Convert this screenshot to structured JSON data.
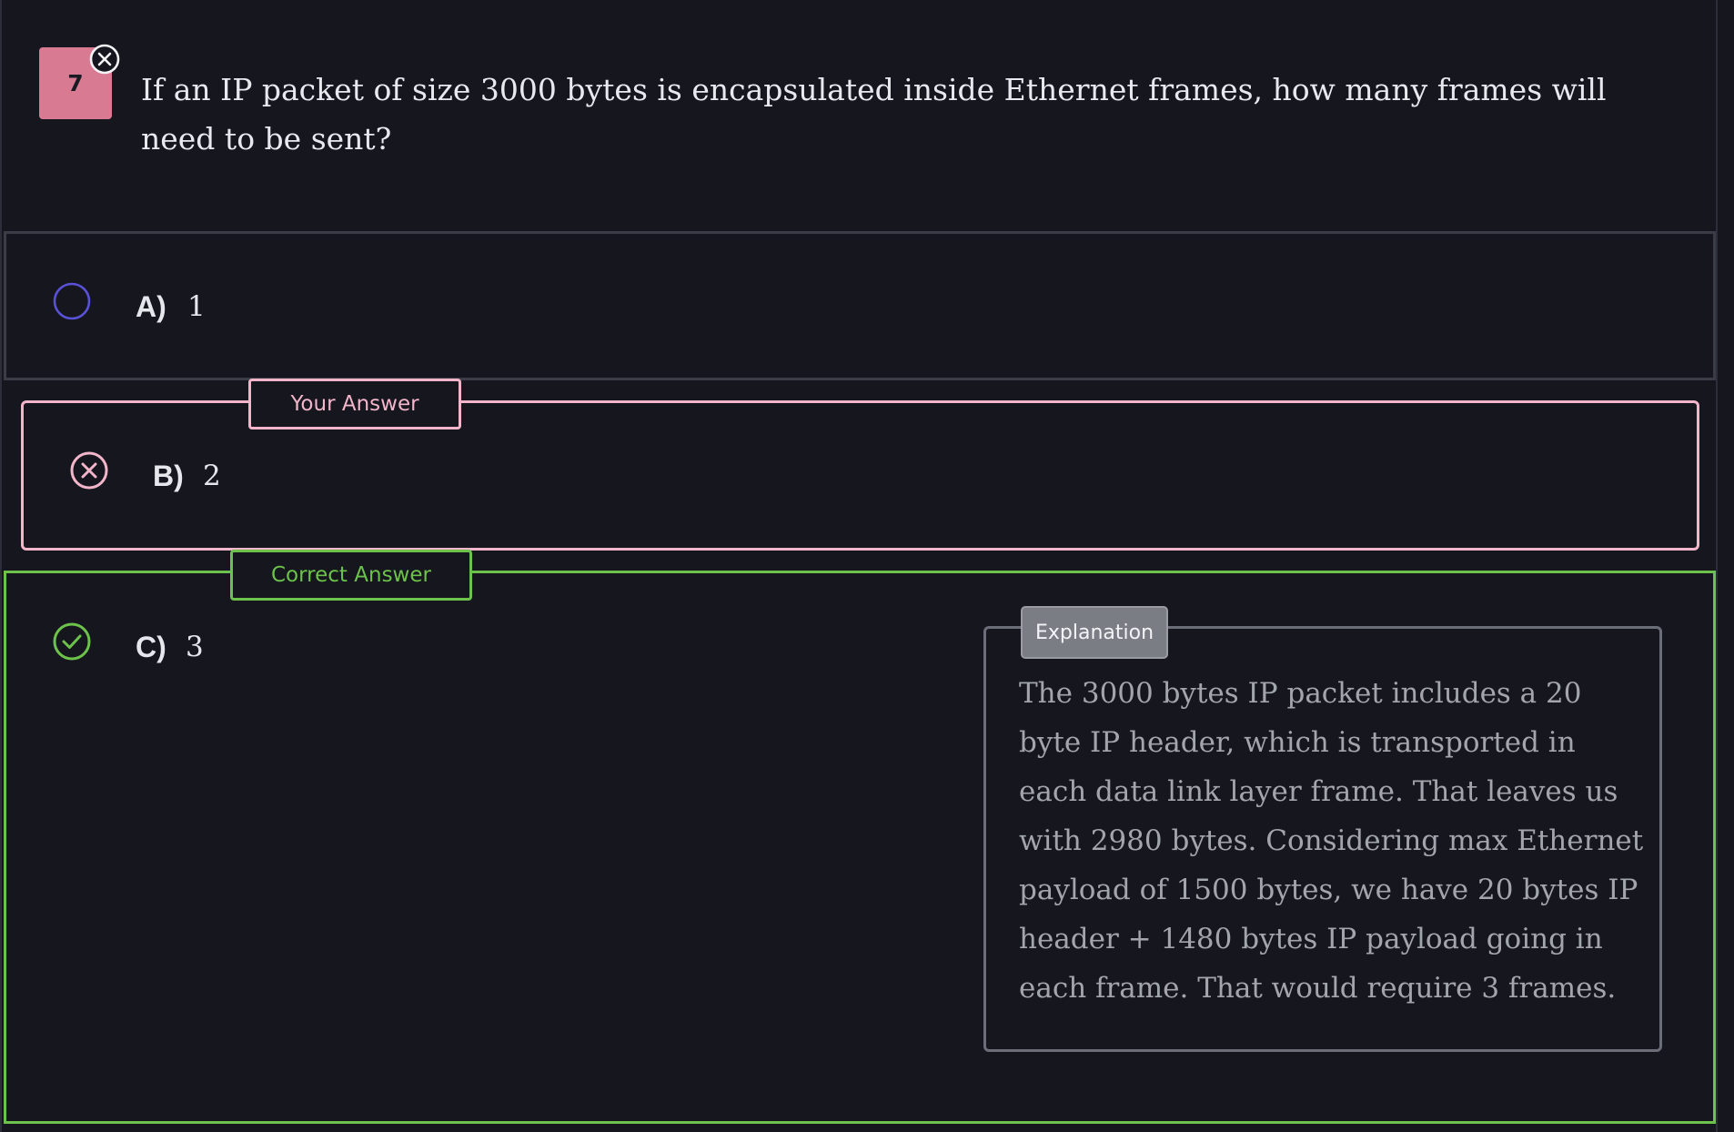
{
  "question": {
    "number": "7",
    "status_icon": "x-circle-icon",
    "text": "If an IP packet of size 3000 bytes is encapsulated inside Ethernet frames, how many frames will need to be sent?"
  },
  "options": [
    {
      "letter": "A)",
      "value": "1",
      "state": "unselected",
      "icon": "empty-radio-icon"
    },
    {
      "letter": "B)",
      "value": "2",
      "state": "selected-wrong",
      "icon": "x-circle-icon",
      "tag": "Your Answer"
    },
    {
      "letter": "C)",
      "value": "3",
      "state": "correct",
      "icon": "check-circle-icon",
      "tag": "Correct Answer"
    }
  ],
  "explanation": {
    "label": "Explanation",
    "text": "The 3000 bytes IP packet includes a 20 byte IP header, which is transported in each data link layer frame. That leaves us with 2980 bytes. Considering max Ethernet payload of 1500 bytes, we have 20 bytes IP header + 1480 bytes IP payload going in each frame. That would require 3 frames."
  },
  "colors": {
    "background": "#15161e",
    "wrong": "#f2b5c9",
    "correct": "#6cc24a",
    "radio": "#5a52d6",
    "badge": "#d97a93"
  }
}
